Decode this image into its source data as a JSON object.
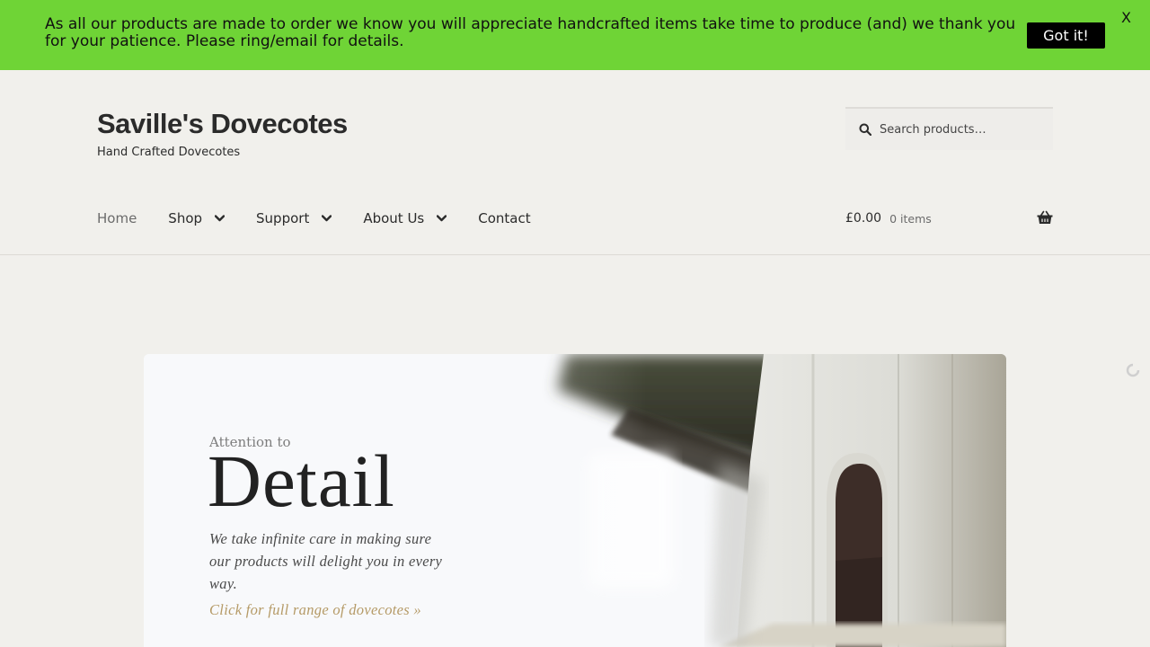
{
  "notice": {
    "text": "As all our products are made to order we know you will appreciate handcrafted items take time to produce (and) we thank you for your patience. Please ring/email for details.",
    "button": "Got it!",
    "close": "X"
  },
  "site": {
    "title": "Saville's Dovecotes",
    "tagline": "Hand Crafted Dovecotes"
  },
  "search": {
    "placeholder": "Search products…"
  },
  "nav": {
    "items": [
      {
        "label": "Home"
      },
      {
        "label": "Shop"
      },
      {
        "label": "Support"
      },
      {
        "label": "About Us"
      },
      {
        "label": "Contact"
      }
    ]
  },
  "cart": {
    "amount": "£0.00",
    "count": "0 items"
  },
  "hero": {
    "eyebrow": "Attention to",
    "heading": "Detail",
    "body": "We take infinite care in making sure our products will delight you in every way.",
    "link": "Click for full range of dovecotes   »"
  },
  "colors": {
    "notice_bg": "#6fd436",
    "page_bg": "#f1f0ec",
    "link_accent": "#b59a66"
  },
  "icons": [
    "search-icon",
    "chevron-down-icon",
    "basket-icon",
    "loading-spinner-icon"
  ]
}
